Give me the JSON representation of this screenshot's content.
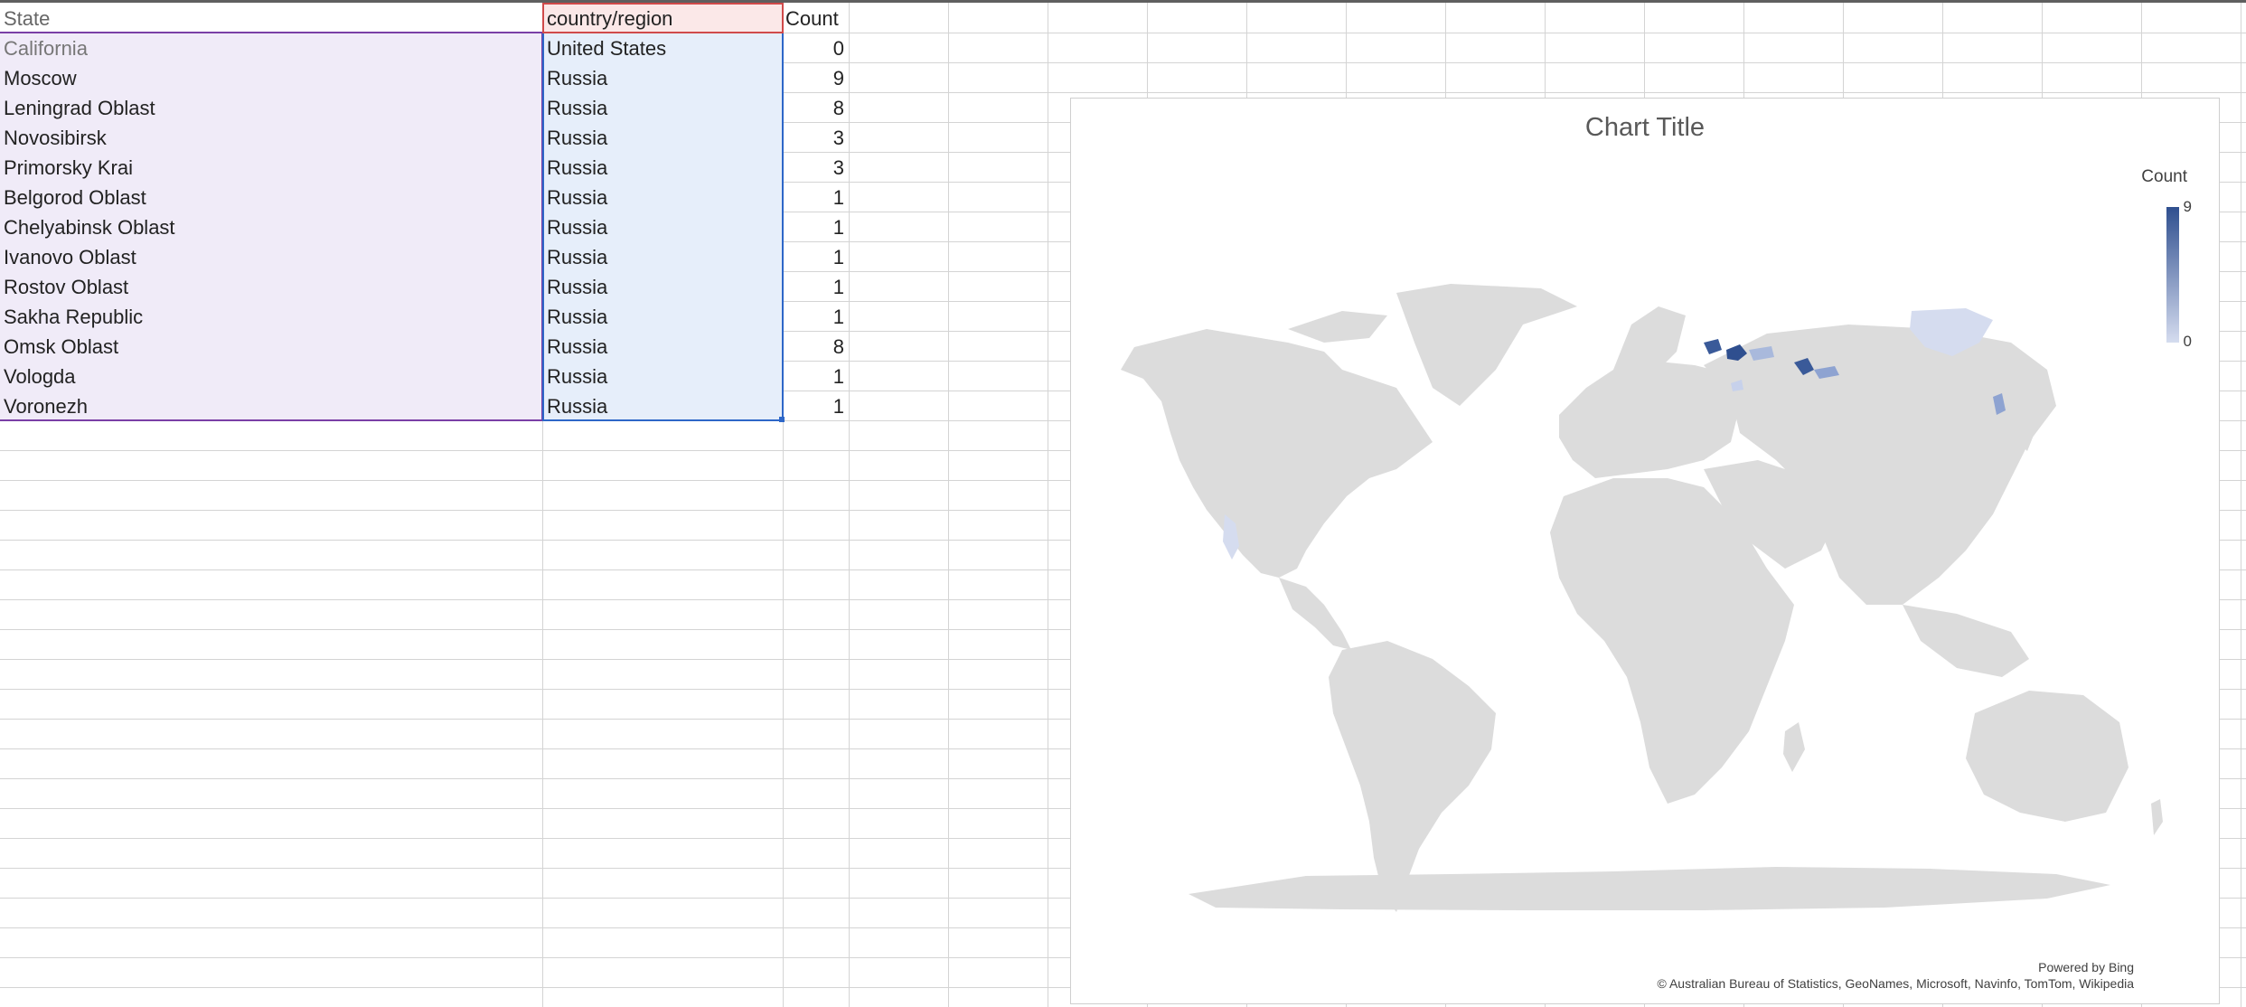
{
  "table": {
    "headers": {
      "state": "State",
      "country": "country/region",
      "count": "Count"
    },
    "rows": [
      {
        "state": "California",
        "country": "United States",
        "count": "0"
      },
      {
        "state": "Moscow",
        "country": "Russia",
        "count": "9"
      },
      {
        "state": "Leningrad Oblast",
        "country": "Russia",
        "count": "8"
      },
      {
        "state": "Novosibirsk",
        "country": "Russia",
        "count": "3"
      },
      {
        "state": "Primorsky Krai",
        "country": "Russia",
        "count": "3"
      },
      {
        "state": "Belgorod Oblast",
        "country": "Russia",
        "count": "1"
      },
      {
        "state": "Chelyabinsk Oblast",
        "country": "Russia",
        "count": "1"
      },
      {
        "state": "Ivanovo Oblast",
        "country": "Russia",
        "count": "1"
      },
      {
        "state": "Rostov Oblast",
        "country": "Russia",
        "count": "1"
      },
      {
        "state": "Sakha Republic",
        "country": "Russia",
        "count": "1"
      },
      {
        "state": "Omsk Oblast",
        "country": "Russia",
        "count": "8"
      },
      {
        "state": "Vologda",
        "country": "Russia",
        "count": "1"
      },
      {
        "state": "Voronezh",
        "country": "Russia",
        "count": "1"
      }
    ]
  },
  "map_chart": {
    "title": "Chart Title",
    "legend_title": "Count",
    "legend_max": "9",
    "legend_min": "0",
    "credit_line1": "Powered by Bing",
    "credit_line2": "© Australian Bureau of Statistics, GeoNames, Microsoft, Navinfo, TomTom, Wikipedia",
    "colors": {
      "high": "#2f4f8f",
      "low": "#d5dcef",
      "land": "#dcdcdc"
    }
  },
  "colors": {
    "state_fill": "#f0ebf8",
    "country_fill": "#e6eefa",
    "header_country_fill": "#fbe8e8",
    "state_border": "#7a3fa6",
    "country_border": "#2e67c8",
    "header_border": "#d04a4a"
  }
}
